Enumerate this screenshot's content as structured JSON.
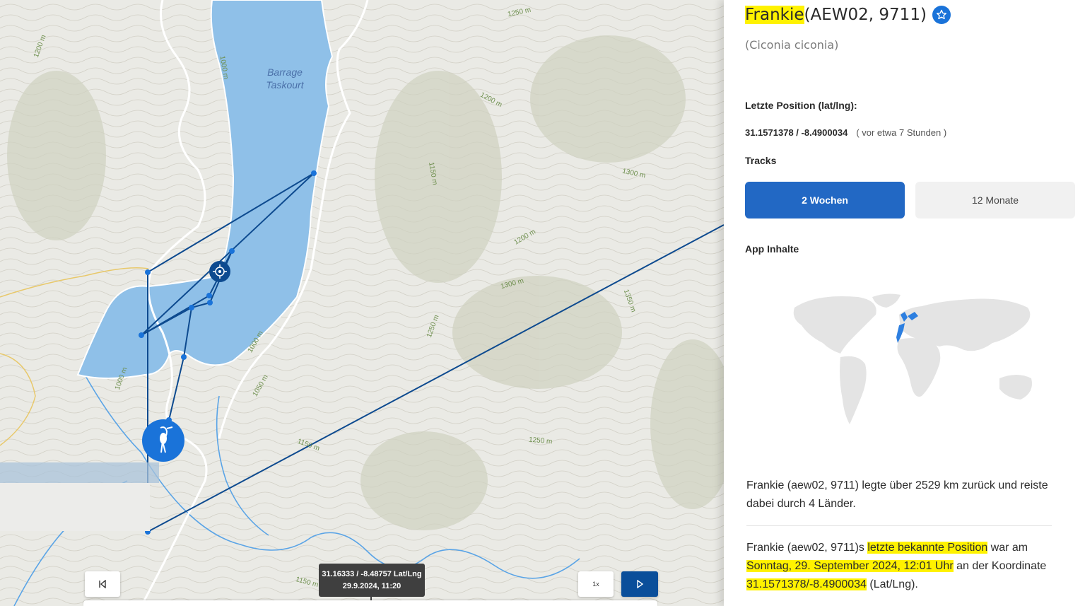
{
  "map": {
    "lake_label_line1": "Barrage",
    "lake_label_line2": "Taskourt",
    "contour_labels": [
      "1250 m",
      "1200 m",
      "1000 m",
      "1200 m",
      "1150 m",
      "1300 m",
      "1200 m",
      "1300 m",
      "1350 m",
      "1250 m",
      "1000 m",
      "1050 m",
      "1000 m",
      "1150 m",
      "1250 m",
      "1150 m"
    ],
    "tooltip_coords": "31.16333 / -8.48757 Lat/Lng",
    "tooltip_time": "29.9.2024, 11:20",
    "speed_label": "1x",
    "colors": {
      "track": "#0d4a8f",
      "lake": "#8fc0e8",
      "river": "#5aa4e6",
      "marker": "#1a73d9"
    }
  },
  "panel": {
    "name": "Frankie",
    "id_text": " (AEW02, 9711)",
    "species": "(Ciconia ciconia)",
    "last_position_label": "Letzte Position (lat/lng):",
    "coords": "31.1571378 / -8.4900034",
    "ago": "( vor etwa 7 Stunden )",
    "tracks_label": "Tracks",
    "track_options": [
      "2 Wochen",
      "12 Monate"
    ],
    "app_label": "App Inhalte",
    "summary": "Frankie (aew02, 9711) legte über 2529 km zurück und reiste dabei durch 4 Länder.",
    "position_text": {
      "p1": "Frankie (aew02, 9711)s ",
      "h1": "letzte bekannte Position",
      "p2": " war am ",
      "h2": "Sonntag, 29. September 2024, 12:01 Uhr",
      "p3": " an der Koordinate ",
      "h3": "31.1571378/-8.4900034",
      "p4": " (Lat/Lng)."
    },
    "colors": {
      "accent": "#2268c4",
      "highlight": "#fff200"
    }
  }
}
